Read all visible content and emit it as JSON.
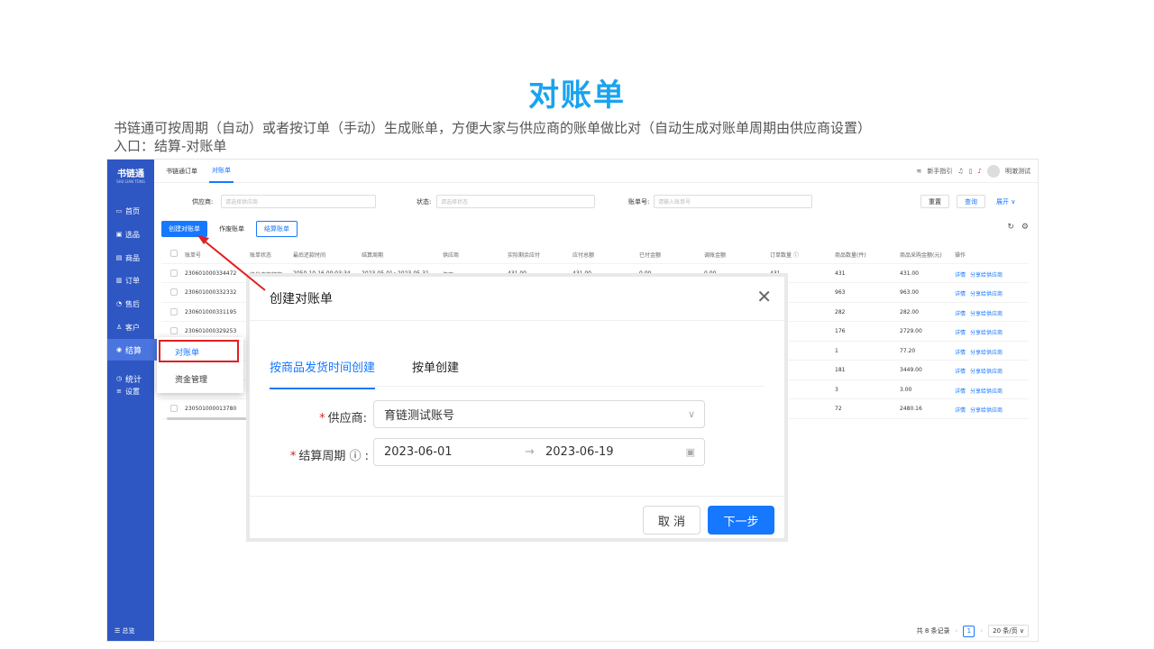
{
  "slide": {
    "title": "对账单",
    "desc_line1": "书链通可按周期（自动）或者按订单（手动）生成账单，方便大家与供应商的账单做比对（自动生成对账单周期由供应商设置）",
    "desc_line2": "入口：结算-对账单"
  },
  "sidebar": {
    "logo": "书链通",
    "logo_sub": "SHU LIAN TONG",
    "items": [
      {
        "label": "首页",
        "icon": "monitor-icon"
      },
      {
        "label": "选品",
        "icon": "grid-icon"
      },
      {
        "label": "商品",
        "icon": "box-icon"
      },
      {
        "label": "订单",
        "icon": "order-icon"
      },
      {
        "label": "售后",
        "icon": "service-icon"
      },
      {
        "label": "客户",
        "icon": "users-icon"
      },
      {
        "label": "结算",
        "icon": "settle-icon"
      },
      {
        "label": "统计",
        "icon": "chart-icon"
      },
      {
        "label": "设置",
        "icon": "gear-icon"
      }
    ],
    "footer": "☰ 总览"
  },
  "topbar": {
    "tabs": [
      "书链通订单",
      "对账单"
    ],
    "guide": "新手指引",
    "user": "明澈测试"
  },
  "filters": {
    "supplier_label": "供应商:",
    "supplier_placeholder": "请选择供应商",
    "status_label": "状态:",
    "status_placeholder": "请选择状态",
    "bill_label": "账单号:",
    "bill_placeholder": "请输入账单号",
    "reset": "重置",
    "search": "查询",
    "expand": "展开 ∨"
  },
  "actions": {
    "create": "创建对账单",
    "void": "作废账单",
    "settle": "结算账单"
  },
  "table": {
    "headers": [
      "账单号",
      "账单状态",
      "最后还款时间",
      "结算周期",
      "供应商",
      "实际剩余应付",
      "应付总额",
      "已付金额",
      "调账金额",
      "订单数量 ⓘ",
      "商品数量(件)",
      "商品采购金额(元)",
      "操作"
    ],
    "rows": [
      {
        "id": "230601000334472",
        "status": "待供应商核实",
        "due": "2050-10-16 00:03:34",
        "period": "2023-05-01~2023-05-31",
        "supplier": "淘宝",
        "remain": "431.00",
        "total": "431.00",
        "paid": "0.00",
        "adjust": "0.00",
        "orders": "431",
        "qty": "431",
        "amount": "431.00"
      },
      {
        "id": "230601000332332",
        "qty": "963",
        "amount": "963.00"
      },
      {
        "id": "230601000331195",
        "qty": "282",
        "amount": "282.00"
      },
      {
        "id": "230601000329253",
        "qty": "176",
        "amount": "2729.00"
      },
      {
        "id": "",
        "qty": "1",
        "amount": "77.20"
      },
      {
        "id": "",
        "qty": "181",
        "amount": "3449.00"
      },
      {
        "id": "",
        "qty": "3",
        "amount": "3.00"
      },
      {
        "id": "230501000013780",
        "qty": "72",
        "amount": "2480.16"
      }
    ],
    "op_detail": "详情",
    "op_share": "分享给供应商"
  },
  "pager": {
    "total": "共 8 条记录",
    "page": "1",
    "size": "20 条/页 ∨"
  },
  "popmenu": {
    "item1": "对账单",
    "item2": "资金管理"
  },
  "dialog": {
    "title": "创建对账单",
    "tab1": "按商品发货时间创建",
    "tab2": "按单创建",
    "supplier_label": "供应商:",
    "supplier_value": "育链测试账号",
    "period_label": "结算周期 ⓘ :",
    "start_date": "2023-06-01",
    "end_date": "2023-06-19",
    "cancel": "取 消",
    "next": "下一步"
  }
}
